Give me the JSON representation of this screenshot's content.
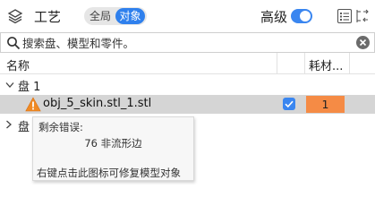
{
  "toolbar": {
    "title": "工艺",
    "layers_icon": "layers-icon",
    "scope_options": [
      "全局",
      "对象"
    ],
    "scope_selected": "对象",
    "advanced_label": "高级",
    "advanced_on": true,
    "list_icon": "list-settings-icon",
    "compare_icon": "compare-icon",
    "accent_color": "#2f80ed"
  },
  "search": {
    "placeholder": "搜索盘、模型和零件。",
    "value": "",
    "search_icon": "search-icon",
    "clear_icon": "clear-icon"
  },
  "table": {
    "columns": [
      "名称",
      "耗材..."
    ],
    "plates": [
      {
        "label": "盘 1",
        "expanded": true,
        "objects": [
          {
            "name": "obj_5_skin.stl_1.stl",
            "warning_icon": "warning-icon",
            "checked": true,
            "filament": "1",
            "filament_color": "#f58b45"
          }
        ]
      },
      {
        "label": "盘 2",
        "expanded": false
      }
    ]
  },
  "tooltip": {
    "title": "剩余错误:",
    "count_line": "76 非流形边",
    "hint": "右键点击此图标可修复模型对象"
  }
}
